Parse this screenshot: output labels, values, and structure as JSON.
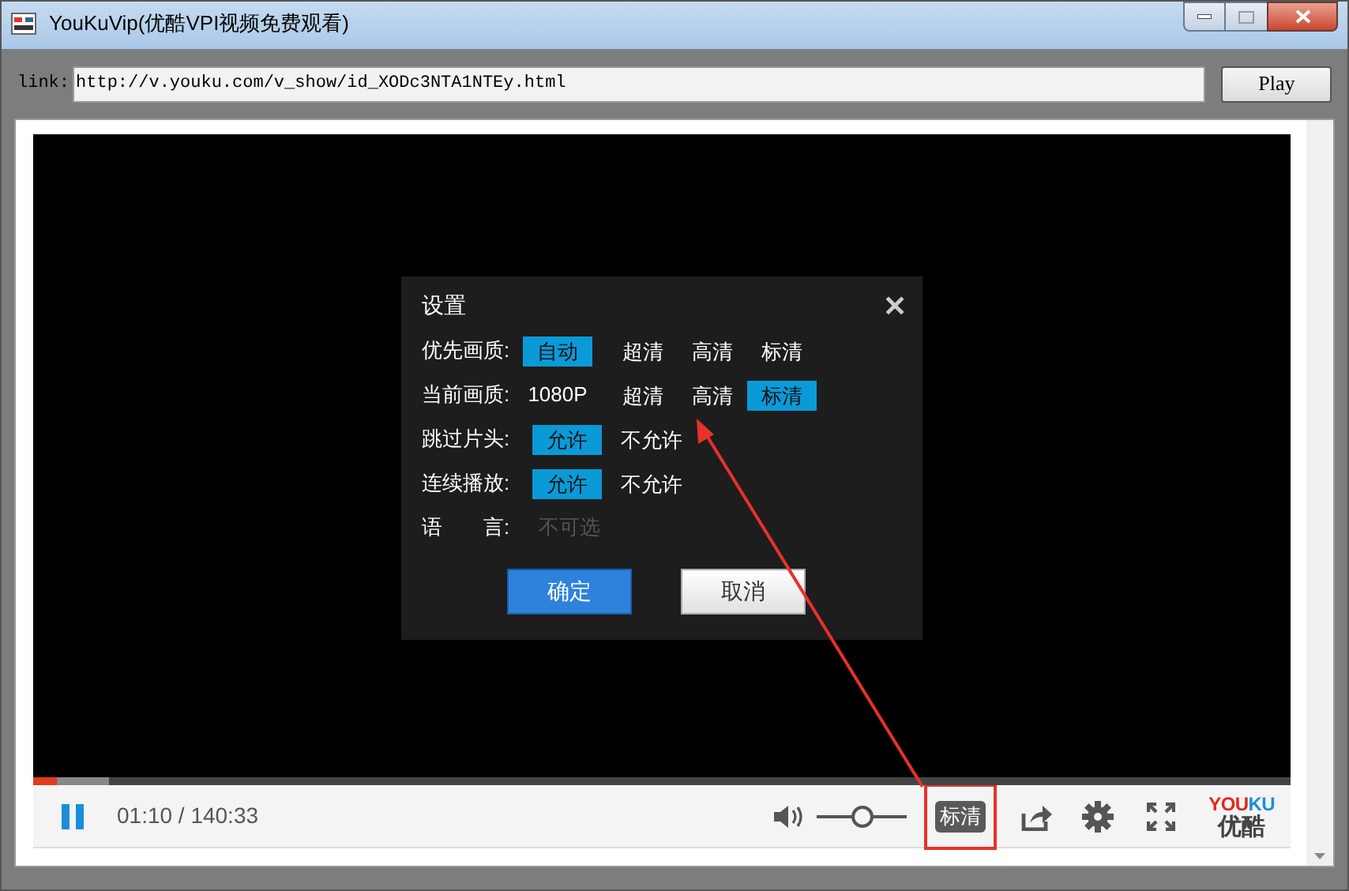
{
  "window": {
    "title": "YouKuVip(优酷VPI视频免费观看)"
  },
  "url_bar": {
    "label": "link:",
    "value": "http://v.youku.com/v_show/id_XODc3NTA1NTEy.html",
    "button": "Play"
  },
  "settings_dialog": {
    "title": "设置",
    "close": "✕",
    "rows": [
      {
        "kind": "options",
        "label": "优先画质:",
        "options": [
          {
            "text": "自动",
            "selected": true
          },
          {
            "text": "超清",
            "selected": false
          },
          {
            "text": "高清",
            "selected": false
          },
          {
            "text": "标清",
            "selected": false
          }
        ]
      },
      {
        "kind": "options",
        "label": "当前画质:",
        "value": "1080P",
        "options": [
          {
            "text": "超清",
            "selected": false
          },
          {
            "text": "高清",
            "selected": false
          },
          {
            "text": "标清",
            "selected": true
          }
        ]
      },
      {
        "kind": "toggle",
        "label": "跳过片头:",
        "options": [
          {
            "text": "允许",
            "selected": true
          },
          {
            "text": "不允许",
            "selected": false
          }
        ]
      },
      {
        "kind": "toggle",
        "label": "连续播放:",
        "options": [
          {
            "text": "允许",
            "selected": true
          },
          {
            "text": "不允许",
            "selected": false
          }
        ]
      },
      {
        "kind": "disabled",
        "label": "语　　言:",
        "value": "不可选"
      }
    ],
    "buttons": [
      {
        "text": "确定",
        "kind": "primary"
      },
      {
        "text": "取消",
        "kind": "secondary"
      }
    ]
  },
  "player": {
    "playing": true,
    "progress": {
      "level": 0.019
    },
    "buffered": {
      "level": 0.06
    },
    "time": "01:10 / 140:33",
    "volume": {
      "level": 0.5
    },
    "quality": "标清",
    "logo": {
      "part_1": "YOU",
      "part_2": "KU",
      "subtitle": "优酷"
    }
  },
  "annotation": {
    "highlight": true
  }
}
